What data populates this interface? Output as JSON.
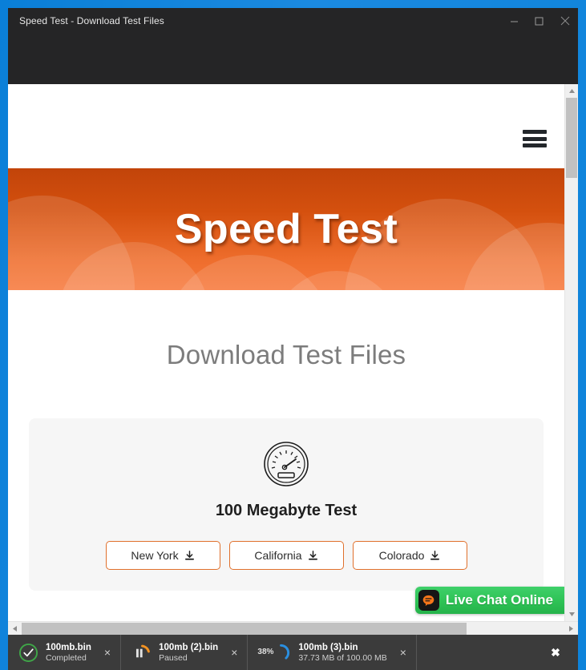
{
  "window": {
    "title": "Speed Test - Download Test Files",
    "minimize_label": "Minimize",
    "maximize_label": "Maximize",
    "close_label": "Close"
  },
  "site": {
    "menu_icon": "hamburger-menu-icon",
    "hero_title": "Speed Test",
    "page_heading": "Download Test Files",
    "card": {
      "gauge_icon": "speedometer-icon",
      "title": "100 Megabyte Test",
      "buttons": [
        {
          "label": "New York",
          "icon": "download-icon"
        },
        {
          "label": "California",
          "icon": "download-icon"
        },
        {
          "label": "Colorado",
          "icon": "download-icon"
        }
      ]
    },
    "live_chat": {
      "label": "Live Chat Online",
      "icon": "chat-bubble-icon",
      "color": "#2ec255"
    },
    "colors": {
      "hero_start": "#c2440a",
      "hero_end": "#f7793c",
      "button_border": "#e0702c",
      "heading": "#7c7c7c"
    }
  },
  "downloads": {
    "items": [
      {
        "name": "100mb.bin",
        "status": "Completed",
        "state": "completed",
        "icon": "check-circle-icon",
        "color": "#3fa648",
        "percent": null,
        "close_label": "×"
      },
      {
        "name": "100mb (2).bin",
        "status": "Paused",
        "state": "paused",
        "icon": "pause-icon",
        "color": "#f29222",
        "percent": null,
        "close_label": "×"
      },
      {
        "name": "100mb (3).bin",
        "status": "37.73 MB of 100.00 MB",
        "state": "downloading",
        "icon": "progress-arc-icon",
        "color": "#2a8fe0",
        "percent": "38%",
        "close_label": "×"
      }
    ],
    "close_all_label": "✖"
  },
  "scrollbars": {
    "vertical_up": "scroll-up-arrow",
    "vertical_down": "scroll-down-arrow",
    "horizontal_left": "scroll-left-arrow",
    "horizontal_right": "scroll-right-arrow"
  }
}
